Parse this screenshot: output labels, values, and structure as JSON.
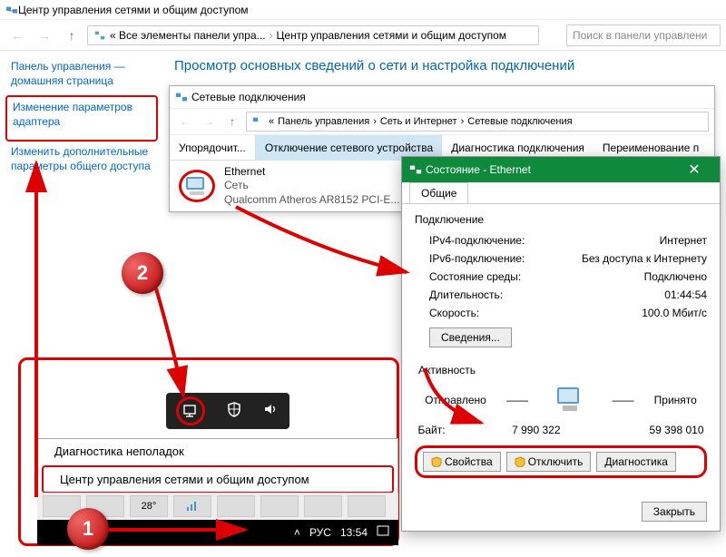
{
  "window_title": "Центр управления сетями и общим доступом",
  "breadcrumb": {
    "root": "Все элементы панели упра...",
    "current": "Центр управления сетями и общим доступом"
  },
  "search_placeholder": "Поиск в панели управлени",
  "sidebar": {
    "home": "Панель управления — домашняя страница",
    "adapter": "Изменение параметров адаптера",
    "sharing": "Изменить дополнительные параметры общего доступа"
  },
  "heading": "Просмотр основных сведений о сети и настройка подключений",
  "inner": {
    "title": "Сетевые подключения",
    "bc1": "Панель управления",
    "bc2": "Сеть и Интернет",
    "bc3": "Сетевые подключения",
    "tb_org": "Упорядочит...",
    "tb_disable": "Отключение сетевого устройства",
    "tb_diag": "Диагностика подключения",
    "tb_rename": "Переименование п",
    "conn_name": "Ethernet",
    "conn_net": "Сеть",
    "conn_dev": "Qualcomm Atheros AR8152 PCI-E..."
  },
  "status": {
    "title": "Состояние - Ethernet",
    "tab": "Общие",
    "group_conn": "Подключение",
    "ipv4_l": "IPv4-подключение:",
    "ipv4_v": "Интернет",
    "ipv6_l": "IPv6-подключение:",
    "ipv6_v": "Без доступа к Интернету",
    "media_l": "Состояние среды:",
    "media_v": "Подключено",
    "dur_l": "Длительность:",
    "dur_v": "01:44:54",
    "speed_l": "Скорость:",
    "speed_v": "100.0 Мбит/с",
    "details_btn": "Сведения...",
    "group_act": "Активность",
    "sent": "Отправлено",
    "recv": "Принято",
    "bytes_l": "Байт:",
    "bytes_sent": "7 990 322",
    "bytes_recv": "59 398 010",
    "btn_props": "Свойства",
    "btn_disable": "Отключить",
    "btn_diag": "Диагностика",
    "btn_close": "Закрыть"
  },
  "popup": {
    "diag": "Диагностика неполадок",
    "center": "Центр управления сетями и общим доступом"
  },
  "taskbar_temp": "28°",
  "lang": "РУС",
  "time": "13:54",
  "badge1": "1",
  "badge2": "2"
}
